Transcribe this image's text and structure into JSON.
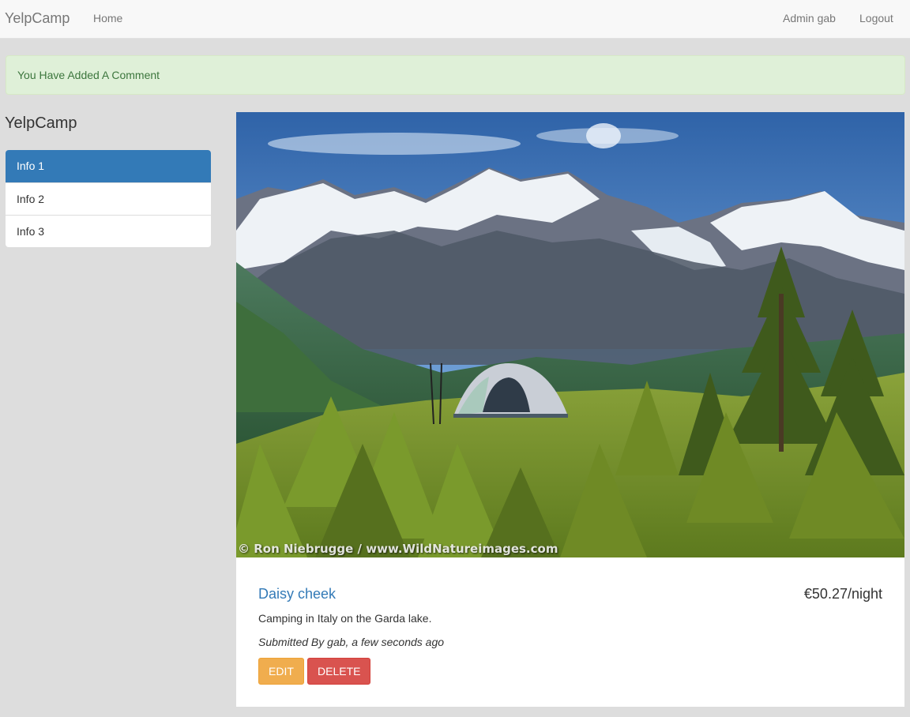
{
  "navbar": {
    "brand": "YelpCamp",
    "home": "Home",
    "user": "Admin gab",
    "logout": "Logout"
  },
  "flash": {
    "message": "You Have Added A Comment",
    "color": "#dff0d8"
  },
  "sidebar": {
    "title": "YelpCamp",
    "items": [
      {
        "label": "Info 1",
        "active": true
      },
      {
        "label": "Info 2",
        "active": false
      },
      {
        "label": "Info 3",
        "active": false
      }
    ],
    "active_color": "#337ab7"
  },
  "campground": {
    "image_watermark": "© Ron Niebrugge / www.WildNatureimages.com",
    "name": "Daisy cheek",
    "price": "€50.27/night",
    "description": "Camping in Italy on the Garda lake.",
    "submitted": "Submitted By gab, a few seconds ago",
    "edit_label": "EDIT",
    "delete_label": "DELETE"
  }
}
